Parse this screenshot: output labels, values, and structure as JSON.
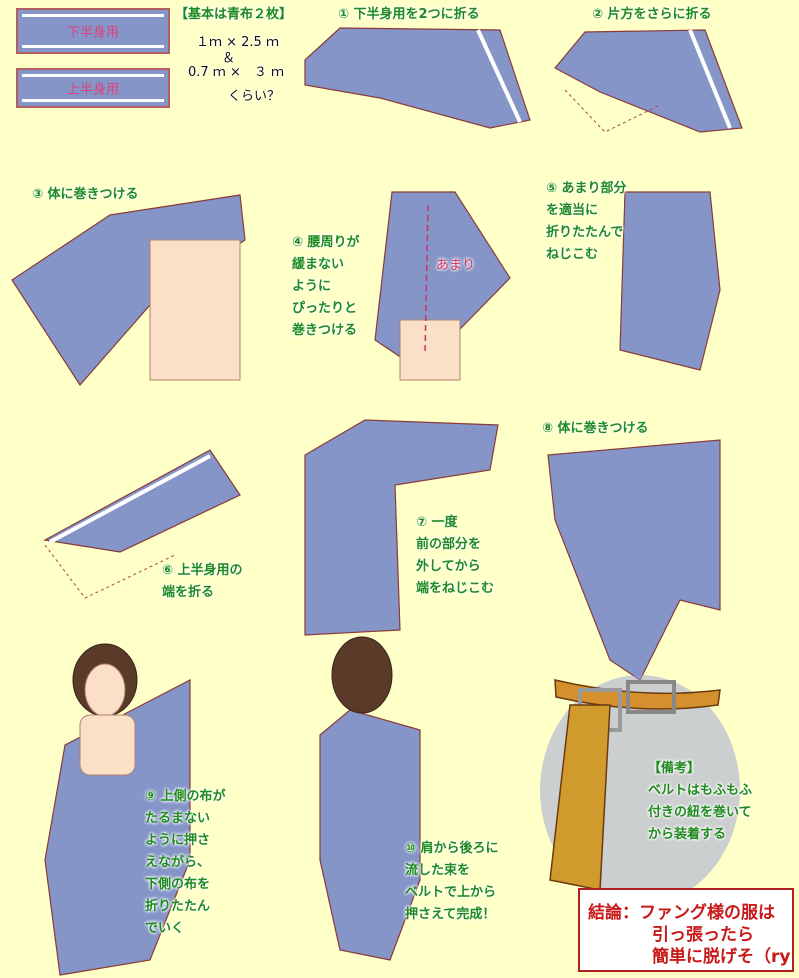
{
  "materials": {
    "swatch_lower": "下半身用",
    "swatch_upper": "上半身用",
    "title": "【基本は青布２枚】",
    "size1": "１ｍ × 2.5 ｍ",
    "amp": "＆",
    "size2": "0.7 ｍ ×　３ ｍ",
    "approx": "くらい？"
  },
  "steps": {
    "s1": "① 下半身用を2つに折る",
    "s2": "② 片方をさらに折る",
    "s3": "③ 体に巻きつける",
    "s4": "④ 腰周りが\n緩まない\nように\nぴったりと\n巻きつける",
    "s4_note": "あまり",
    "s5": "⑤ あまり部分\nを適当に\n折りたたんで\nねじこむ",
    "s6": "⑥ 上半身用の\n端を折る",
    "s7": "⑦ 一度\n前の部分を\n外してから\n端をねじこむ",
    "s8": "⑧ 体に巻きつける",
    "s9": "⑨ 上側の布が\nたるまない\nように押さ\nえながら、\n下側の布を\n折りたたん\nでいく",
    "s10": "⑩ 肩から後ろに\n流した束を\nベルトで上から\n押さえて完成！"
  },
  "note": {
    "title": "【備考】",
    "body": "ベルトはもふもふ\n付きの紐を巻いて\nから装着する"
  },
  "conclusion": {
    "line1": "結論：ファング様の服は",
    "line2": "引っ張ったら",
    "line3": "簡単に脱げそ（ry"
  },
  "colors": {
    "background": "#ffffc8",
    "cloth": "#8595c8",
    "text_green": "#1f8a1f",
    "conclusion_red": "#c81818"
  }
}
